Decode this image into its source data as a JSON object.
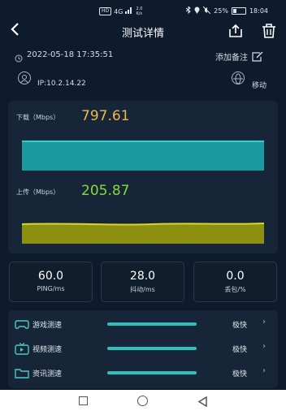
{
  "status": {
    "net_tag": "HD",
    "net_type": "4G",
    "speed_top": "2.0",
    "speed_bottom": "K/s",
    "battery": "25%",
    "time": "18:04"
  },
  "header": {
    "title": "测试详情"
  },
  "info": {
    "datetime": "2022-05-18 17:35:51",
    "add_note": "添加备注",
    "ip": "IP:10.2.14.22",
    "carrier": "移动"
  },
  "download": {
    "label": "下载（Mbps）",
    "value": "797.61",
    "bar_color": "#1a9aa0"
  },
  "upload": {
    "label": "上传（Mbps）",
    "value": "205.87",
    "bar_color": "#b6b417"
  },
  "stats": [
    {
      "value": "60.0",
      "label": "PING/ms"
    },
    {
      "value": "28.0",
      "label": "抖动/ms"
    },
    {
      "value": "0.0",
      "label": "丢包/%"
    }
  ],
  "rows": [
    {
      "label": "游戏测速",
      "speed": "极快",
      "icon": "gamepad-icon"
    },
    {
      "label": "视频测速",
      "speed": "极快",
      "icon": "tv-icon"
    },
    {
      "label": "资讯测速",
      "speed": "极快",
      "icon": "folder-icon"
    }
  ]
}
